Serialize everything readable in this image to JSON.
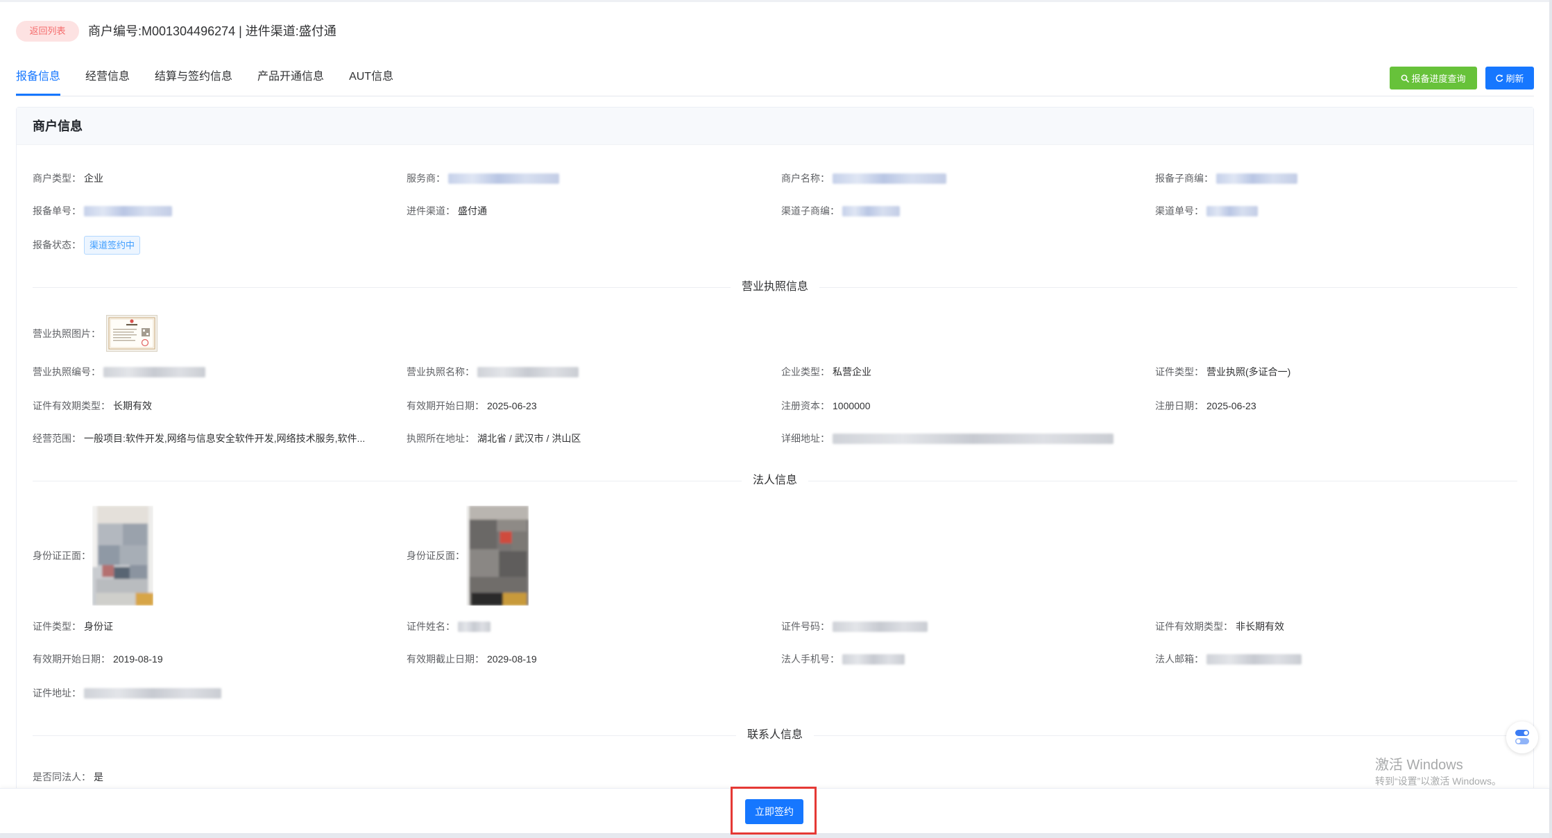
{
  "header": {
    "back_label": "返回列表",
    "title": "商户编号:M001304496274 | 进件渠道:盛付通"
  },
  "tabs": [
    {
      "label": "报备信息",
      "active": true
    },
    {
      "label": "经营信息"
    },
    {
      "label": "结算与签约信息"
    },
    {
      "label": "产品开通信息"
    },
    {
      "label": "AUT信息"
    }
  ],
  "actions": {
    "query_icon": "search-icon",
    "query_label": "报备进度查询",
    "refresh_icon": "refresh-icon",
    "refresh_label": "刷新"
  },
  "merchant": {
    "title": "商户信息",
    "fields": [
      {
        "label": "商户类型：",
        "value": "企业"
      },
      {
        "label": "服务商："
      },
      {
        "label": "商户名称："
      },
      {
        "label": "报备子商编："
      },
      {
        "label": "报备单号："
      },
      {
        "label": "进件渠道：",
        "value": "盛付通"
      },
      {
        "label": "渠道子商编："
      },
      {
        "label": "渠道单号："
      },
      {
        "label": "报备状态：",
        "value": "渠道签约中"
      }
    ]
  },
  "license": {
    "title": "营业执照信息",
    "image_label": "营业执照图片：",
    "fields": [
      {
        "label": "营业执照编号："
      },
      {
        "label": "营业执照名称："
      },
      {
        "label": "企业类型：",
        "value": "私营企业"
      },
      {
        "label": "证件类型：",
        "value": "营业执照(多证合一)"
      },
      {
        "label": "证件有效期类型：",
        "value": "长期有效"
      },
      {
        "label": "有效期开始日期：",
        "value": "2025-06-23"
      },
      {
        "label": "注册资本：",
        "value": "1000000"
      },
      {
        "label": "注册日期：",
        "value": "2025-06-23"
      },
      {
        "label": "经营范围：",
        "value": "一般项目:软件开发,网络与信息安全软件开发,网络技术服务,软件..."
      },
      {
        "label": "执照所在地址：",
        "value": "湖北省 / 武汉市 / 洪山区"
      },
      {
        "label": "详细地址："
      }
    ]
  },
  "legal": {
    "title": "法人信息",
    "id_front_label": "身份证正面：",
    "id_back_label": "身份证反面：",
    "fields": [
      {
        "label": "证件类型：",
        "value": "身份证"
      },
      {
        "label": "证件姓名："
      },
      {
        "label": "证件号码："
      },
      {
        "label": "证件有效期类型：",
        "value": "非长期有效"
      },
      {
        "label": "有效期开始日期：",
        "value": "2019-08-19"
      },
      {
        "label": "有效期截止日期：",
        "value": "2029-08-19"
      },
      {
        "label": "法人手机号："
      },
      {
        "label": "法人邮箱："
      },
      {
        "label": "证件地址："
      }
    ]
  },
  "contact": {
    "title": "联系人信息",
    "fields": [
      {
        "label": "是否同法人：",
        "value": "是"
      }
    ]
  },
  "footer": {
    "sign_label": "立即签约"
  },
  "watermark": {
    "line1": "激活 Windows",
    "line2": "转到“设置”以激活 Windows。"
  },
  "colors": {
    "accent": "#1677ff",
    "success": "#67c23a",
    "danger": "#f56c6c",
    "highlight": "#e53935"
  }
}
